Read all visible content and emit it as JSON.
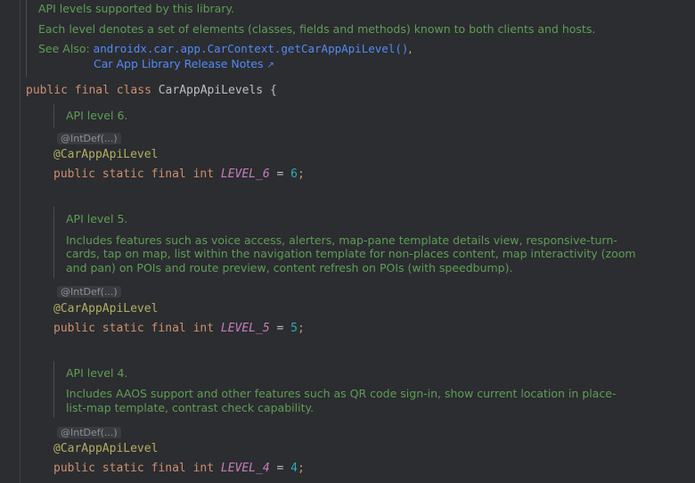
{
  "top_doc": {
    "line1": "API levels supported by this library.",
    "line2": "Each level denotes a set of elements (classes, fields and methods) known to both clients and hosts.",
    "see_also_label": "See Also:",
    "see_also_link1": "androidx.car.app.CarContext.getCarAppApiLevel()",
    "see_also_sep": ",",
    "see_also_link2": "Car App Library Release Notes",
    "external_arrow": "↗"
  },
  "class_decl": {
    "kw_public": "public",
    "kw_final": "final",
    "kw_class": "class",
    "name": "CarAppApiLevels",
    "brace": "{"
  },
  "fields": [
    {
      "doc_title": "API level 6.",
      "doc_lines": [],
      "fold": "@IntDef(...)",
      "annotation": "@CarAppApiLevel",
      "kw_public": "public",
      "kw_static": "static",
      "kw_final": "final",
      "type": "int",
      "name": "LEVEL_6",
      "equals": "=",
      "value": "6",
      "semicolon": ";"
    },
    {
      "doc_title": "API level 5.",
      "doc_lines": [
        "Includes features such as voice access, alerters, map-pane template details view, responsive-turn-",
        "cards, tap on map, list within the navigation template for non-places content, map interactivity (zoom",
        "and pan) on POIs and route preview, content refresh on POIs (with speedbump)."
      ],
      "fold": "@IntDef(...)",
      "annotation": "@CarAppApiLevel",
      "kw_public": "public",
      "kw_static": "static",
      "kw_final": "final",
      "type": "int",
      "name": "LEVEL_5",
      "equals": "=",
      "value": "5",
      "semicolon": ";"
    },
    {
      "doc_title": "API level 4.",
      "doc_lines": [
        "Includes AAOS support and other features such as QR code sign-in, show current location in place-",
        "list-map template, contrast check capability."
      ],
      "fold": "@IntDef(...)",
      "annotation": "@CarAppApiLevel",
      "kw_public": "public",
      "kw_static": "static",
      "kw_final": "final",
      "type": "int",
      "name": "LEVEL_4",
      "equals": "=",
      "value": "4",
      "semicolon": ";"
    }
  ]
}
